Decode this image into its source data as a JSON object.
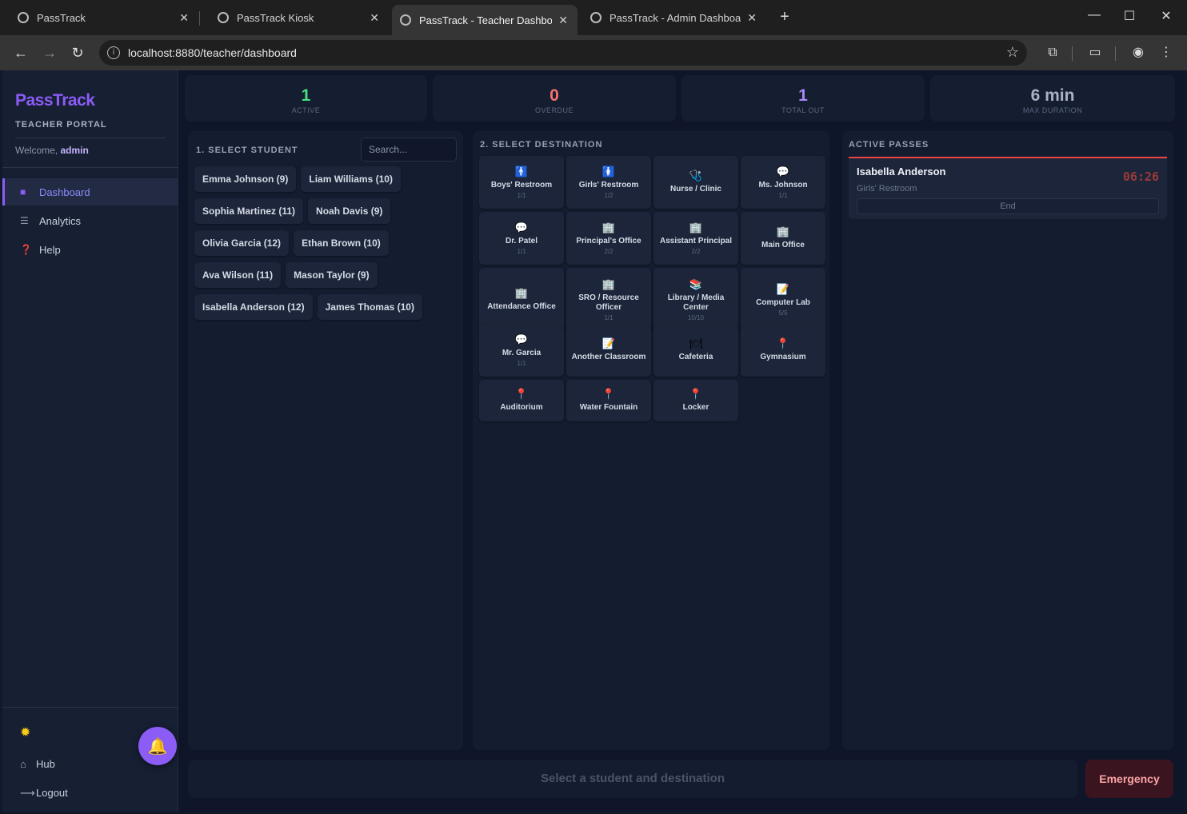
{
  "browser": {
    "tabs": [
      {
        "label": "PassTrack"
      },
      {
        "label": "PassTrack Kiosk"
      },
      {
        "label": "PassTrack - Teacher Dashboard"
      },
      {
        "label": "PassTrack - Admin Dashboard"
      }
    ],
    "url": "localhost:8880/teacher/dashboard"
  },
  "sidebar": {
    "logo": "PassTrack",
    "portal": "TEACHER PORTAL",
    "welcome_prefix": "Welcome, ",
    "user": "admin",
    "nav": [
      {
        "label": "Dashboard",
        "icon": "square-icon"
      },
      {
        "label": "Analytics",
        "icon": "list-icon"
      },
      {
        "label": "Help",
        "icon": "question-icon"
      }
    ],
    "footer": [
      {
        "label": "Hub",
        "icon": "home-icon"
      },
      {
        "label": "Logout",
        "icon": "logout-icon"
      }
    ]
  },
  "stats": [
    {
      "value": "1",
      "label": "ACTIVE",
      "color": "#4ade80"
    },
    {
      "value": "0",
      "label": "OVERDUE",
      "color": "#f87171"
    },
    {
      "value": "1",
      "label": "TOTAL OUT",
      "color": "#a78bfa"
    },
    {
      "value": "6 min",
      "label": "MAX DURATION",
      "color": "#aab2c5"
    }
  ],
  "student_panel": {
    "title": "1. SELECT STUDENT",
    "search_placeholder": "Search...",
    "students": [
      "Emma Johnson (9)",
      "Liam Williams (10)",
      "Sophia Martinez (11)",
      "Noah Davis (9)",
      "Olivia Garcia (12)",
      "Ethan Brown (10)",
      "Ava Wilson (11)",
      "Mason Taylor (9)",
      "Isabella Anderson (12)",
      "James Thomas (10)"
    ]
  },
  "destination_panel": {
    "title": "2. SELECT DESTINATION",
    "destinations": [
      {
        "name": "Boys' Restroom",
        "count": "1/1",
        "icon": "🚹"
      },
      {
        "name": "Girls' Restroom",
        "count": "1/2",
        "icon": "🚺"
      },
      {
        "name": "Nurse / Clinic",
        "count": "",
        "icon": "🩺"
      },
      {
        "name": "Ms. Johnson",
        "count": "1/1",
        "icon": "💬"
      },
      {
        "name": "Dr. Patel",
        "count": "1/1",
        "icon": "💬"
      },
      {
        "name": "Principal's Office",
        "count": "2/2",
        "icon": "🏢"
      },
      {
        "name": "Assistant Principal",
        "count": "2/2",
        "icon": "🏢"
      },
      {
        "name": "Main Office",
        "count": "",
        "icon": "🏢"
      },
      {
        "name": "Attendance Office",
        "count": "",
        "icon": "🏢"
      },
      {
        "name": "SRO / Resource Officer",
        "count": "1/1",
        "icon": "🏢"
      },
      {
        "name": "Library / Media Center",
        "count": "10/10",
        "icon": "📚"
      },
      {
        "name": "Computer Lab",
        "count": "5/5",
        "icon": "📝"
      },
      {
        "name": "Mr. Garcia",
        "count": "1/1",
        "icon": "💬"
      },
      {
        "name": "Another Classroom",
        "count": "",
        "icon": "📝"
      },
      {
        "name": "Cafeteria",
        "count": "",
        "icon": "🍽"
      },
      {
        "name": "Gymnasium",
        "count": "",
        "icon": "📍"
      },
      {
        "name": "Auditorium",
        "count": "",
        "icon": "📍"
      },
      {
        "name": "Water Fountain",
        "count": "",
        "icon": "📍"
      },
      {
        "name": "Locker",
        "count": "",
        "icon": "📍"
      }
    ]
  },
  "passes_panel": {
    "title": "ACTIVE PASSES",
    "passes": [
      {
        "name": "Isabella Anderson",
        "destination": "Girls' Restroom",
        "timer": "06:26",
        "end_label": "End"
      }
    ]
  },
  "action_bar": {
    "prompt": "Select a student and destination",
    "emergency": "Emergency"
  }
}
